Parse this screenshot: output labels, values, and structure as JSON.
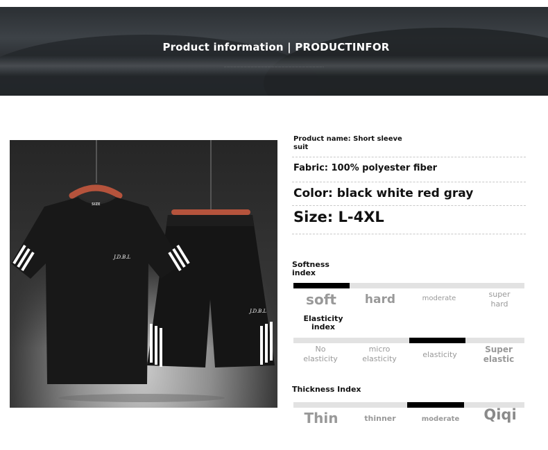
{
  "banner": {
    "title": "Product information | PRODUCTINFOR",
    "subtitle": "..................................................................................................................."
  },
  "photo": {
    "shirt_logo": "J.D.B.L",
    "shorts_logo": "J.D.B.L",
    "neck_tag": "SIZE"
  },
  "specs": {
    "name": "Product name: Short sleeve suit",
    "fabric": "Fabric: 100% polyester fiber",
    "color": "Color: black white red gray",
    "size": "Size: L-4XL"
  },
  "softness": {
    "label": "Softness index",
    "options": [
      "soft",
      "hard",
      "moderate",
      "super hard"
    ],
    "selected_index": 0
  },
  "elasticity": {
    "label": "Elasticity index",
    "options": [
      "No elasticity",
      "micro elasticity",
      "elasticity",
      "Super elastic"
    ],
    "selected_index": 2
  },
  "thickness": {
    "label": "Thickness Index",
    "options": [
      "Thin",
      "thinner",
      "moderate",
      "Qiqi"
    ],
    "selected_index": 2
  },
  "colors": {
    "bar_bg": "#e2e2e2",
    "bar_selected": "#000000",
    "hanger": "#b5533c"
  }
}
